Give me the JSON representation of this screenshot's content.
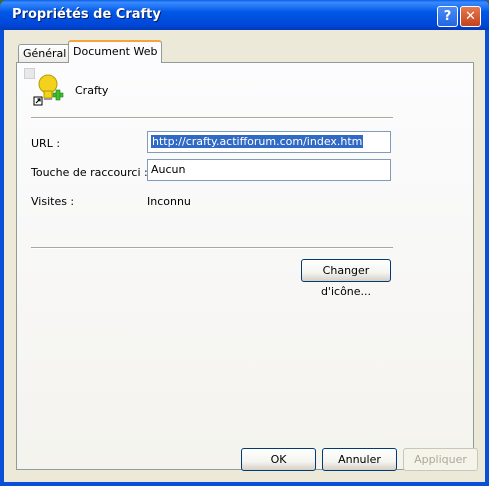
{
  "window": {
    "title": "Propriétés de Crafty",
    "help_label": "?",
    "close_label": "✕"
  },
  "tabs": [
    {
      "label": "Général",
      "active": false
    },
    {
      "label": "Document Web",
      "active": true
    }
  ],
  "shortcut": {
    "name": "Crafty",
    "icon": "shortcut-lightbulb-icon"
  },
  "fields": {
    "url_label": "URL :",
    "url_value": "http://crafty.actifforum.com/index.htm",
    "hotkey_label": "Touche de raccourci :",
    "hotkey_value": "Aucun",
    "visits_label": "Visites :",
    "visits_value": "Inconnu"
  },
  "buttons": {
    "change_icon": "Changer d'icône...",
    "ok": "OK",
    "cancel": "Annuler",
    "apply": "Appliquer"
  },
  "colors": {
    "titlebar": "#0058e6",
    "selection": "#316ac5",
    "active_tab_accent": "#f7a23a",
    "dialog_bg": "#ece9d8"
  }
}
